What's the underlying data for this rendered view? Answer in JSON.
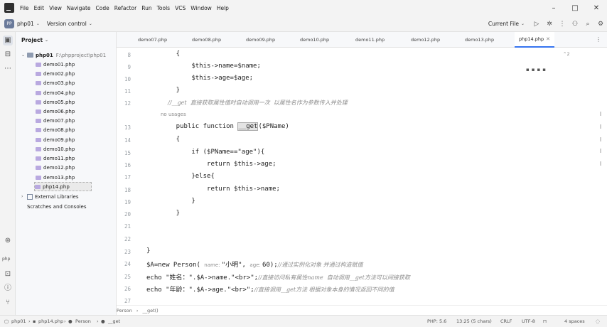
{
  "menubar": {
    "items": [
      "File",
      "Edit",
      "View",
      "Navigate",
      "Code",
      "Refactor",
      "Run",
      "Tools",
      "VCS",
      "Window",
      "Help"
    ]
  },
  "toolbar": {
    "project_badge": "PP",
    "project_name": "php01",
    "vcs": "Version control",
    "run_config": "Current File"
  },
  "sidebar": {
    "php_label": "php"
  },
  "project_panel": {
    "title": "Project",
    "root_name": "php01",
    "root_path": "F:\\phpproject\\php01",
    "files": [
      "demo01.php",
      "demo02.php",
      "demo03.php",
      "demo04.php",
      "demo05.php",
      "demo06.php",
      "demo07.php",
      "demo08.php",
      "demo09.php",
      "demo10.php",
      "demo11.php",
      "demo12.php",
      "demo13.php",
      "php14.php"
    ],
    "external": "External Libraries",
    "scratches": "Scratches and Consoles"
  },
  "tabs": [
    "demo07.php",
    "demo08.php",
    "demo09.php",
    "demo10.php",
    "demo11.php",
    "demo12.php",
    "demo13.php",
    "php14.php"
  ],
  "editor": {
    "warn_count": "2",
    "usages": "no usages",
    "lines": [
      {
        "num": "8",
        "text": "    {"
      },
      {
        "num": "9",
        "text": "        $this->name=$name;"
      },
      {
        "num": "10",
        "text": "        $this->age=$age;"
      },
      {
        "num": "11",
        "text": "    }"
      },
      {
        "num": "12",
        "text": "    //__get  直接获取属性值时自动调用一次  以属性名作为参数传入并处理"
      },
      {
        "num": "13",
        "pre": "    public function ",
        "hl": "__get",
        "post": "($PName)"
      },
      {
        "num": "14",
        "text": "    {"
      },
      {
        "num": "15",
        "text": "        if ($PName==\"age\"){"
      },
      {
        "num": "16",
        "text": "            return $this->age;"
      },
      {
        "num": "17",
        "text": "        }else{"
      },
      {
        "num": "18",
        "text": "            return $this->name;"
      },
      {
        "num": "19",
        "text": "        }"
      },
      {
        "num": "20",
        "text": "    }"
      },
      {
        "num": "21",
        "text": ""
      },
      {
        "num": "22",
        "text": ""
      },
      {
        "num": "23",
        "text": "}"
      },
      {
        "num": "24",
        "pre": "$A=new Person( ",
        "hint1": "name: ",
        "mid1": "\"小明\", ",
        "hint2": "age: ",
        "mid2": "60);",
        "cmt": "//通过实例化对象 并通过构造赋值"
      },
      {
        "num": "25",
        "pre": "echo \"姓名：\".$A->name.\"<br>\";",
        "cmt": "//直接访问私有属性name  自动调用__get方法可以间接获取"
      },
      {
        "num": "26",
        "pre": "echo \"年龄：\".$A->age.\"<br>\";",
        "cmt": "//直接调用__get方法 根据对象本身的情况返回不同的值"
      },
      {
        "num": "27",
        "text": ""
      }
    ]
  },
  "breadcrumb": [
    "Person",
    "__get()"
  ],
  "statusbar": {
    "path": [
      "php01",
      "php14.php",
      "Person",
      "__get"
    ],
    "php_version": "PHP: 5.6",
    "position": "13:25 (5 chars)",
    "line_sep": "CRLF",
    "encoding": "UTF-8",
    "indent": "4 spaces"
  }
}
